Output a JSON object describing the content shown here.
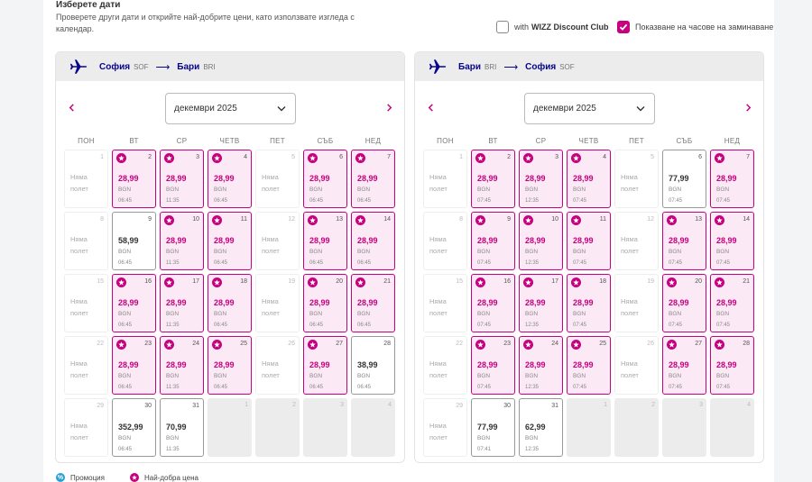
{
  "header": {
    "title": "Изберете дати",
    "description": "Проверете други дати и открийте най-добрите цени, като използвате изгледа с календар."
  },
  "options": {
    "discount_label": "with",
    "discount_brand": "WIZZ Discount Club",
    "discount_checked": false,
    "show_times_label": "Показване на часове на заминаване",
    "show_times_checked": true
  },
  "weekdays": [
    "ПОН",
    "ВТ",
    "СР",
    "ЧЕТВ",
    "ПЕТ",
    "СЪБ",
    "НЕД"
  ],
  "no_flight_label": "Няма полет",
  "legend": {
    "promo_icon": "%",
    "promo_label": "Промоция",
    "best_label": "Най-добра цена"
  },
  "colors": {
    "brand_navy": "#06038d",
    "brand_magenta": "#c6007e",
    "promo_blue": "#2a9fd6"
  },
  "calendars": [
    {
      "from_city": "София",
      "from_code": "SOF",
      "to_city": "Бари",
      "to_code": "BRI",
      "month_label": "декември 2025",
      "days": [
        {
          "d": "1",
          "type": "none"
        },
        {
          "d": "2",
          "type": "best",
          "price": "28,99",
          "cur": "BGN",
          "time": "06:45"
        },
        {
          "d": "3",
          "type": "best",
          "price": "28,99",
          "cur": "BGN",
          "time": "11:35"
        },
        {
          "d": "4",
          "type": "best",
          "price": "28,99",
          "cur": "BGN",
          "time": "06:45"
        },
        {
          "d": "5",
          "type": "none"
        },
        {
          "d": "6",
          "type": "best",
          "price": "28,99",
          "cur": "BGN",
          "time": "06:45"
        },
        {
          "d": "7",
          "type": "best",
          "price": "28,99",
          "cur": "BGN",
          "time": "06:45"
        },
        {
          "d": "8",
          "type": "none"
        },
        {
          "d": "9",
          "type": "flight",
          "price": "58,99",
          "cur": "BGN",
          "time": "06:45"
        },
        {
          "d": "10",
          "type": "best",
          "price": "28,99",
          "cur": "BGN",
          "time": "11:35"
        },
        {
          "d": "11",
          "type": "best",
          "price": "28,99",
          "cur": "BGN",
          "time": "06:45"
        },
        {
          "d": "12",
          "type": "none"
        },
        {
          "d": "13",
          "type": "best",
          "price": "28,99",
          "cur": "BGN",
          "time": "06:45"
        },
        {
          "d": "14",
          "type": "best",
          "price": "28,99",
          "cur": "BGN",
          "time": "06:45"
        },
        {
          "d": "15",
          "type": "none"
        },
        {
          "d": "16",
          "type": "best",
          "price": "28,99",
          "cur": "BGN",
          "time": "06:45"
        },
        {
          "d": "17",
          "type": "best",
          "price": "28,99",
          "cur": "BGN",
          "time": "11:35"
        },
        {
          "d": "18",
          "type": "best",
          "price": "28,99",
          "cur": "BGN",
          "time": "06:45"
        },
        {
          "d": "19",
          "type": "none"
        },
        {
          "d": "20",
          "type": "best",
          "price": "28,99",
          "cur": "BGN",
          "time": "06:45"
        },
        {
          "d": "21",
          "type": "best",
          "price": "28,99",
          "cur": "BGN",
          "time": "06:45"
        },
        {
          "d": "22",
          "type": "none"
        },
        {
          "d": "23",
          "type": "best",
          "price": "28,99",
          "cur": "BGN",
          "time": "06:45"
        },
        {
          "d": "24",
          "type": "best",
          "price": "28,99",
          "cur": "BGN",
          "time": "11:35"
        },
        {
          "d": "25",
          "type": "best",
          "price": "28,99",
          "cur": "BGN",
          "time": "06:45"
        },
        {
          "d": "26",
          "type": "none"
        },
        {
          "d": "27",
          "type": "best",
          "price": "28,99",
          "cur": "BGN",
          "time": "06:45"
        },
        {
          "d": "28",
          "type": "flight",
          "price": "38,99",
          "cur": "BGN",
          "time": "06:45"
        },
        {
          "d": "29",
          "type": "none"
        },
        {
          "d": "30",
          "type": "flight",
          "price": "352,99",
          "cur": "BGN",
          "time": "06:45"
        },
        {
          "d": "31",
          "type": "flight",
          "price": "70,99",
          "cur": "BGN",
          "time": "11:35"
        },
        {
          "d": "1",
          "type": "empty"
        },
        {
          "d": "2",
          "type": "empty"
        },
        {
          "d": "3",
          "type": "empty"
        },
        {
          "d": "4",
          "type": "empty"
        }
      ]
    },
    {
      "from_city": "Бари",
      "from_code": "BRI",
      "to_city": "София",
      "to_code": "SOF",
      "month_label": "декември 2025",
      "days": [
        {
          "d": "1",
          "type": "none"
        },
        {
          "d": "2",
          "type": "best",
          "price": "28,99",
          "cur": "BGN",
          "time": "07:45"
        },
        {
          "d": "3",
          "type": "best",
          "price": "28,99",
          "cur": "BGN",
          "time": "12:35"
        },
        {
          "d": "4",
          "type": "best",
          "price": "28,99",
          "cur": "BGN",
          "time": "07:45"
        },
        {
          "d": "5",
          "type": "none"
        },
        {
          "d": "6",
          "type": "flight",
          "price": "77,99",
          "cur": "BGN",
          "time": "07:45"
        },
        {
          "d": "7",
          "type": "best",
          "price": "28,99",
          "cur": "BGN",
          "time": "07:45"
        },
        {
          "d": "8",
          "type": "none"
        },
        {
          "d": "9",
          "type": "best",
          "price": "28,99",
          "cur": "BGN",
          "time": "07:45"
        },
        {
          "d": "10",
          "type": "best",
          "price": "28,99",
          "cur": "BGN",
          "time": "12:35"
        },
        {
          "d": "11",
          "type": "best",
          "price": "28,99",
          "cur": "BGN",
          "time": "07:45"
        },
        {
          "d": "12",
          "type": "none"
        },
        {
          "d": "13",
          "type": "best",
          "price": "28,99",
          "cur": "BGN",
          "time": "07:45"
        },
        {
          "d": "14",
          "type": "best",
          "price": "28,99",
          "cur": "BGN",
          "time": "07:45"
        },
        {
          "d": "15",
          "type": "none"
        },
        {
          "d": "16",
          "type": "best",
          "price": "28,99",
          "cur": "BGN",
          "time": "07:45"
        },
        {
          "d": "17",
          "type": "best",
          "price": "28,99",
          "cur": "BGN",
          "time": "12:35"
        },
        {
          "d": "18",
          "type": "best",
          "price": "28,99",
          "cur": "BGN",
          "time": "07:45"
        },
        {
          "d": "19",
          "type": "none"
        },
        {
          "d": "20",
          "type": "best",
          "price": "28,99",
          "cur": "BGN",
          "time": "07:45"
        },
        {
          "d": "21",
          "type": "best",
          "price": "28,99",
          "cur": "BGN",
          "time": "07:45"
        },
        {
          "d": "22",
          "type": "none"
        },
        {
          "d": "23",
          "type": "best",
          "price": "28,99",
          "cur": "BGN",
          "time": "07:45"
        },
        {
          "d": "24",
          "type": "best",
          "price": "28,99",
          "cur": "BGN",
          "time": "12:35"
        },
        {
          "d": "25",
          "type": "best",
          "price": "28,99",
          "cur": "BGN",
          "time": "07:45"
        },
        {
          "d": "26",
          "type": "none"
        },
        {
          "d": "27",
          "type": "best",
          "price": "28,99",
          "cur": "BGN",
          "time": "07:45"
        },
        {
          "d": "28",
          "type": "best",
          "price": "28,99",
          "cur": "BGN",
          "time": "07:45"
        },
        {
          "d": "29",
          "type": "none"
        },
        {
          "d": "30",
          "type": "flight",
          "price": "77,99",
          "cur": "BGN",
          "time": "07:41"
        },
        {
          "d": "31",
          "type": "flight",
          "price": "62,99",
          "cur": "BGN",
          "time": "12:35"
        },
        {
          "d": "1",
          "type": "empty"
        },
        {
          "d": "2",
          "type": "empty"
        },
        {
          "d": "3",
          "type": "empty"
        },
        {
          "d": "4",
          "type": "empty"
        }
      ]
    }
  ]
}
